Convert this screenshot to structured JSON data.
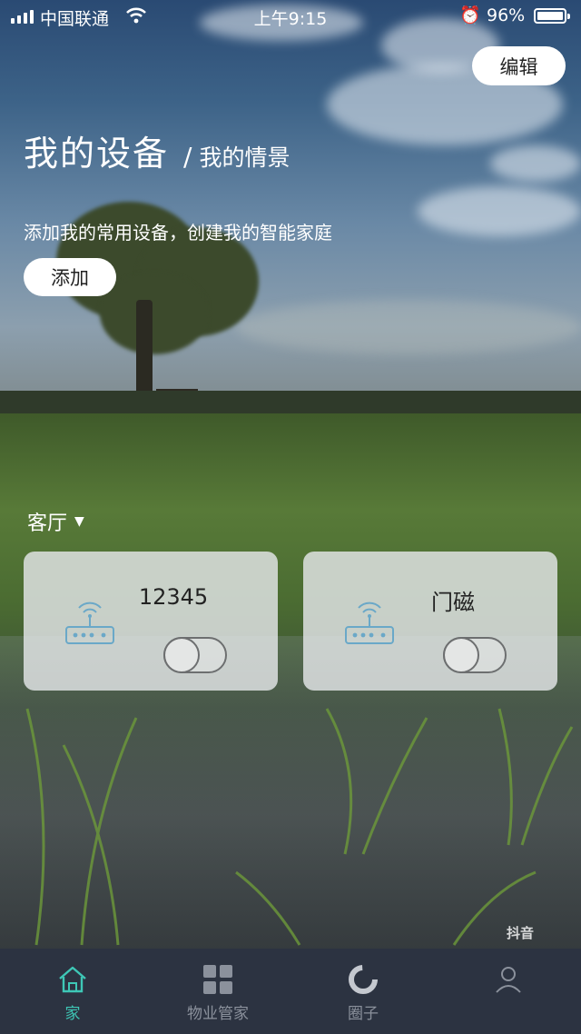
{
  "status_bar": {
    "carrier": "中国联通",
    "time": "上午9:15",
    "battery": "96%",
    "wifi_icon": "wifi-icon",
    "alarm_icon": "alarm-icon"
  },
  "header": {
    "edit_label": "编辑",
    "title": "我的设备",
    "separator": "/",
    "subtitle": "我的情景",
    "description": "添加我的常用设备，创建我的智能家庭",
    "add_label": "添加"
  },
  "room": {
    "name": "客厅",
    "caret_icon": "caret-down-icon"
  },
  "devices": [
    {
      "name": "12345",
      "icon": "router-icon",
      "on": false
    },
    {
      "name": "门磁",
      "icon": "router-icon",
      "on": false
    }
  ],
  "watermark": "抖音",
  "tabs": [
    {
      "label": "家",
      "icon": "home-icon",
      "active": true
    },
    {
      "label": "物业管家",
      "icon": "grid-icon",
      "active": false
    },
    {
      "label": "圈子",
      "icon": "ring-icon",
      "active": false
    },
    {
      "label": "",
      "icon": "person-icon",
      "active": false
    }
  ],
  "colors": {
    "accent": "#3ec7b6",
    "tabbar_bg": "#2c3341",
    "tab_inactive": "#8b919c"
  }
}
